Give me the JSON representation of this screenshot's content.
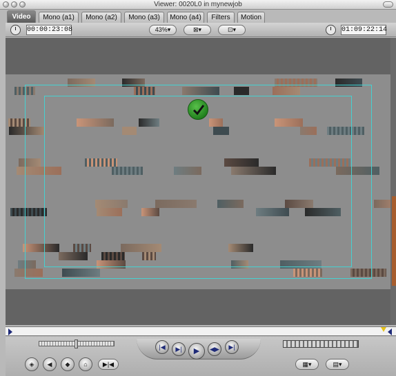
{
  "window": {
    "title": "Viewer: 0020L0 in mynewjob"
  },
  "tabs": [
    {
      "label": "Video",
      "active": true
    },
    {
      "label": "Mono (a1)"
    },
    {
      "label": "Mono (a2)"
    },
    {
      "label": "Mono (a3)"
    },
    {
      "label": "Mono (a4)"
    },
    {
      "label": "Filters"
    },
    {
      "label": "Motion"
    }
  ],
  "controls": {
    "duration_timecode": "00:00:23:08",
    "zoom_label": "43%",
    "current_timecode": "01:09:22:14"
  },
  "transport": {
    "buttons": [
      "previous-edit",
      "play-in-to-out",
      "play",
      "play-around-current",
      "next-edit"
    ],
    "lower_left_buttons": [
      "match-frame",
      "mark-in",
      "mark-clip",
      "add-keyframe",
      "mark-out-split"
    ]
  },
  "colors": {
    "safe_area": "#45d2d2",
    "status_check": "#2e9a27",
    "timeline_playhead": "#e6c21a",
    "transport_icons": "#1e2a78"
  }
}
